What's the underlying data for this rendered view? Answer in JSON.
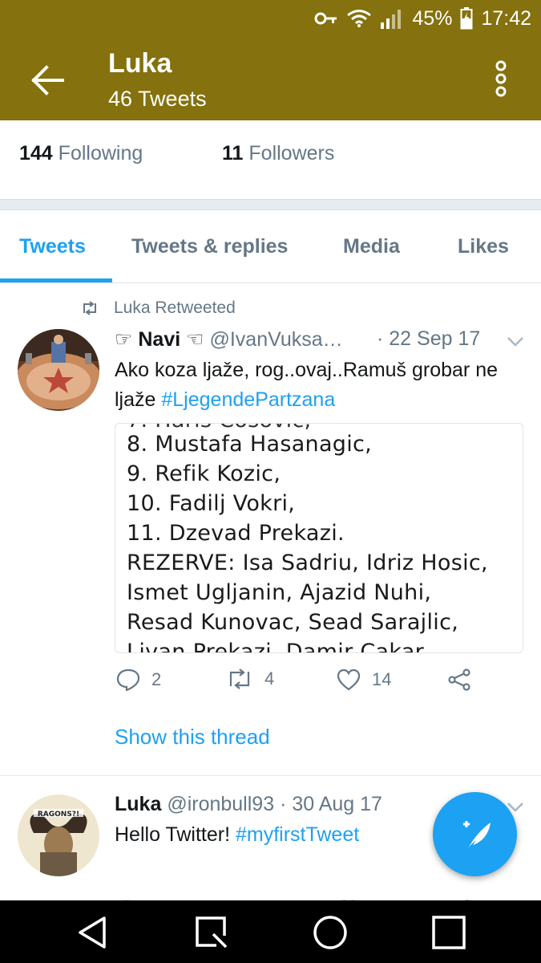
{
  "status_bar": {
    "battery": "45%",
    "time": "17:42",
    "icons": [
      "key-icon",
      "wifi-icon",
      "signal-icon",
      "battery-charging-icon"
    ]
  },
  "header": {
    "name": "Luka",
    "tweet_count": "46 Tweets",
    "background_color": "#85710d"
  },
  "profile": {
    "following_count": "144",
    "following_label": "Following",
    "followers_count": "11",
    "followers_label": "Followers"
  },
  "tabs": [
    {
      "label": "Tweets",
      "active": true
    },
    {
      "label": "Tweets & replies",
      "active": false
    },
    {
      "label": "Media",
      "active": false
    },
    {
      "label": "Likes",
      "active": false
    }
  ],
  "tweets": [
    {
      "retweet_label": "Luka Retweeted",
      "name": "☞ Navi ☜",
      "handle": "@IvanVuksa…",
      "date": "· 22 Sep 17",
      "text": "Ako koza ljaže, rog..ovaj..Ramuš grobar ne ljaže",
      "hashtag": "#LjegendePartzana",
      "media_lines": [
        "8. Mustafa Hasanagic,",
        "9. Refik Kozic,",
        "10. Fadilj Vokri,",
        "11. Dzevad Prekazi.",
        "REZERVE: Isa Sadriu, Idriz Hosic,",
        "Ismet Ugljanin, Ajazid Nuhi,",
        "Resad Kunovac, Sead Sarajlic,"
      ],
      "replies": "2",
      "retweets": "4",
      "likes": "14",
      "thread_link": "Show this thread"
    },
    {
      "name": "Luka",
      "handle": "@ironbull93",
      "date": "· 30 Aug 17",
      "text": "Hello Twitter!",
      "hashtag": "#myfirstTweet"
    }
  ],
  "accent_color": "#1da1f2",
  "nav_bar": [
    "back-icon",
    "recents-icon",
    "home-icon",
    "overview-icon"
  ]
}
